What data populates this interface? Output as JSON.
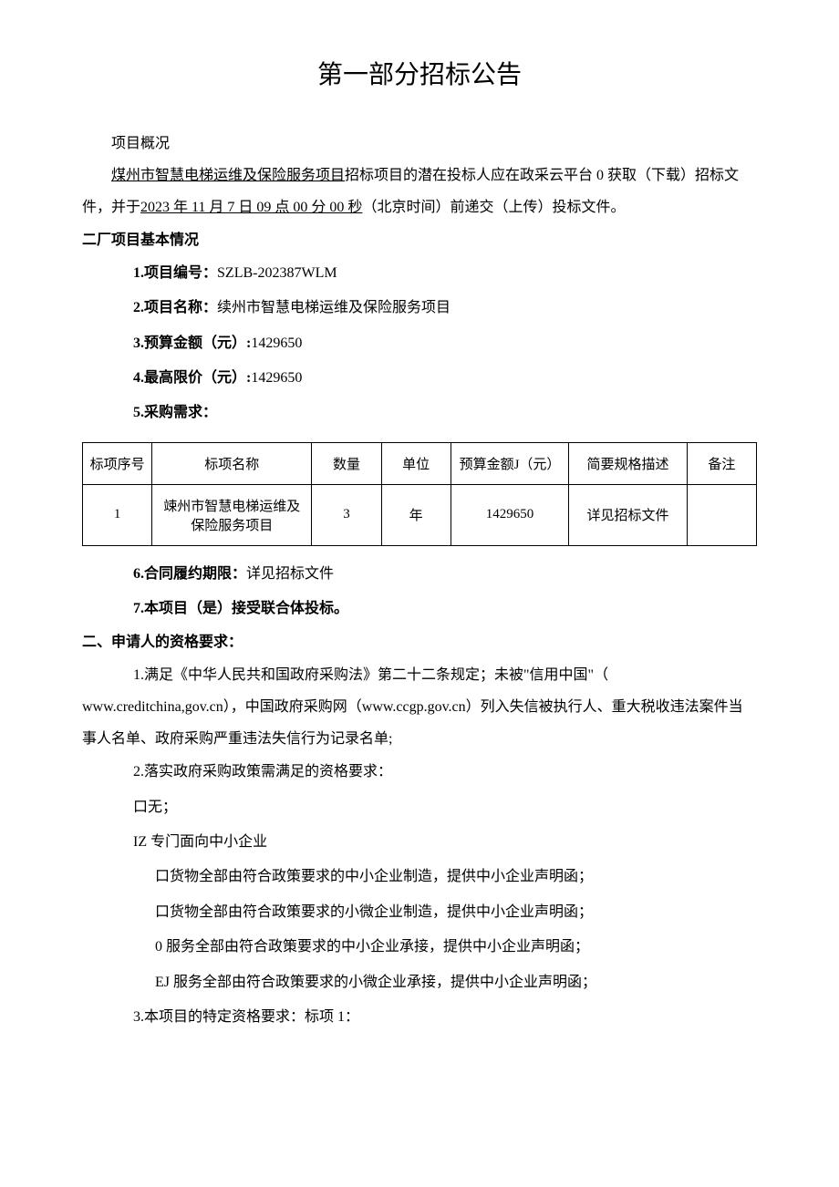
{
  "title": "第一部分招标公告",
  "overview_label": "项目概况",
  "overview_project_u": "煤州市智慧电梯运维及保险服务项目",
  "overview_mid1": "招标项目的潜在投标人应在政采云平台 0 获取（下载）招标文件，并于",
  "overview_date_u": "2023 年 11 月 7 日 09 点 00 分 00 秒",
  "overview_mid2": "（北京时间）前递交（上传）投标文件。",
  "section1_head": "二厂项目基本情况",
  "items": {
    "i1_label": "1.项目编号：",
    "i1_val": "SZLB-202387WLM",
    "i2_label": "2.项目名称：",
    "i2_val": "续州市智慧电梯运维及保险服务项目",
    "i3_label": "3.预算金额（元）:",
    "i3_val": "1429650",
    "i4_label": "4.最高限价（元）:",
    "i4_val": "1429650",
    "i5_label": "5.采购需求：",
    "i6_label": "6.合同履约期限：",
    "i6_val": "详见招标文件",
    "i7_label": "7.本项目（是）接受联合体投标。"
  },
  "table": {
    "headers": {
      "c1": "标项序号",
      "c2": "标项名称",
      "c3": "数量",
      "c4": "单位",
      "c5": "预算金额J（元）",
      "c6": "简要规格描述",
      "c7": "备注"
    },
    "row1": {
      "c1": "1",
      "c2": "竦州市智慧电梯运维及保险服务项目",
      "c3": "3",
      "c4": "年",
      "c5": "1429650",
      "c6": "详见招标文件",
      "c7": ""
    }
  },
  "section2_head": "二、申请人的资格要求：",
  "qual": {
    "q1_a": "1.满足《中华人民共和国政府采购法》第二十二条规定；未被\"信用中国\"（",
    "q1_b": "www.creditchina,gov.cn），中国政府采购网（www.ccgp.gov.cn）列入失信被执行人、重大税收违法案件当事人名单、政府采购严重违法失信行为记录名单;",
    "q2": "2.落实政府采购政策需满足的资格要求：",
    "q2_opt_none": "口无；",
    "q2_opt_sme": "IZ 专门面向中小企业",
    "q2_sub1": "口货物全部由符合政策要求的中小企业制造，提供中小企业声明函；",
    "q2_sub2": "口货物全部由符合政策要求的小微企业制造，提供中小企业声明函；",
    "q2_sub3": "0 服务全部由符合政策要求的中小企业承接，提供中小企业声明函；",
    "q2_sub4": "EJ 服务全部由符合政策要求的小微企业承接，提供中小企业声明函；",
    "q3": "3.本项目的特定资格要求：标项 1："
  }
}
